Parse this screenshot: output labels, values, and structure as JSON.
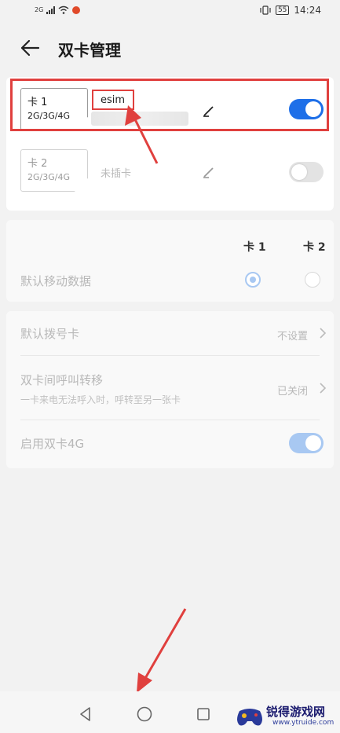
{
  "status_bar": {
    "network": "2G",
    "time": "14:24",
    "battery": "55"
  },
  "app": {
    "title": "双卡管理"
  },
  "sims": [
    {
      "slot": "卡 1",
      "bands": "2G/3G/4G",
      "name": "esim",
      "enabled": true
    },
    {
      "slot": "卡 2",
      "bands": "2G/3G/4G",
      "name": "未插卡",
      "enabled": false
    }
  ],
  "data_section": {
    "col1": "卡 1",
    "col2": "卡 2",
    "default_data_label": "默认移动数据",
    "selected": "卡 1"
  },
  "settings": {
    "default_dial_label": "默认拨号卡",
    "default_dial_value": "不设置",
    "forward_label": "双卡间呼叫转移",
    "forward_sub": "一卡来电无法呼入时，呼转至另一张卡",
    "forward_value": "已关闭",
    "dual4g_label": "启用双卡4G",
    "dual4g_enabled": true
  },
  "watermark": {
    "title": "锐得游戏网",
    "url": "www.ytruide.com"
  },
  "colors": {
    "accent": "#1e6fe8",
    "annotation": "#e0403e"
  },
  "icons": [
    "back-arrow-icon",
    "edit-pencil-icon",
    "chevron-right-icon",
    "nav-back-icon",
    "nav-home-icon",
    "nav-recent-icon"
  ]
}
